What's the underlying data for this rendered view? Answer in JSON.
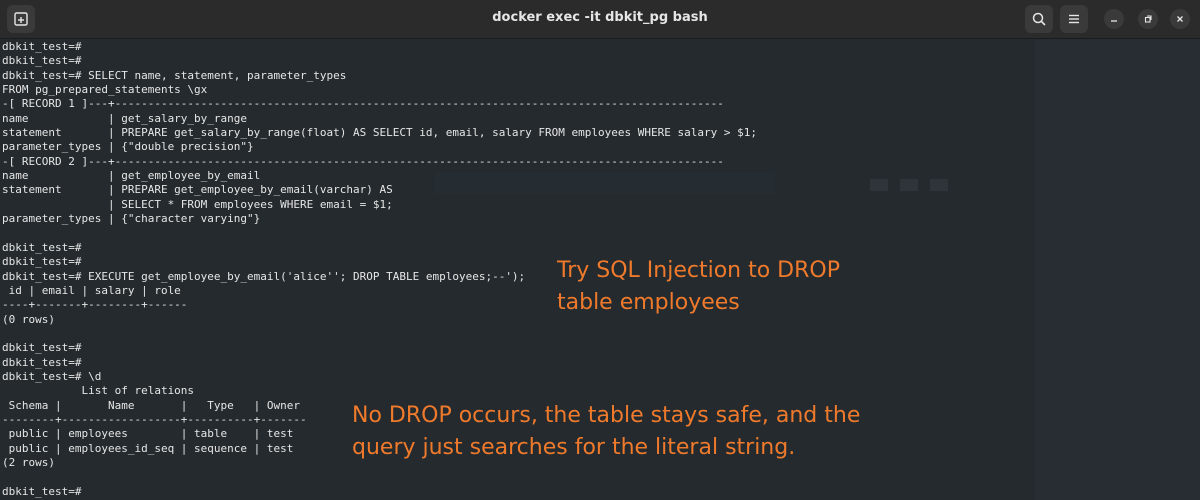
{
  "window": {
    "title": "docker exec -it dbkit_pg bash"
  },
  "terminal": {
    "lines": [
      "dbkit_test=#",
      "dbkit_test=#",
      "dbkit_test=# SELECT name, statement, parameter_types",
      "FROM pg_prepared_statements \\gx",
      "-[ RECORD 1 ]---+--------------------------------------------------------------------------------------------",
      "name            | get_salary_by_range",
      "statement       | PREPARE get_salary_by_range(float) AS SELECT id, email, salary FROM employees WHERE salary > $1;",
      "parameter_types | {\"double precision\"}",
      "-[ RECORD 2 ]---+--------------------------------------------------------------------------------------------",
      "name            | get_employee_by_email",
      "statement       | PREPARE get_employee_by_email(varchar) AS",
      "                | SELECT * FROM employees WHERE email = $1;",
      "parameter_types | {\"character varying\"}",
      "",
      "dbkit_test=#",
      "dbkit_test=#",
      "dbkit_test=# EXECUTE get_employee_by_email('alice''; DROP TABLE employees;--');",
      " id | email | salary | role",
      "----+-------+--------+------",
      "(0 rows)",
      "",
      "dbkit_test=#",
      "dbkit_test=#",
      "dbkit_test=# \\d",
      "            List of relations",
      " Schema |       Name       |   Type   | Owner",
      "--------+------------------+----------+-------",
      " public | employees        | table    | test",
      " public | employees_id_seq | sequence | test",
      "(2 rows)",
      "",
      "dbkit_test=#"
    ]
  },
  "annotations": {
    "injection": [
      "Try SQL Injection to DROP",
      "table employees"
    ],
    "result": [
      "No DROP occurs, the table stays safe, and the",
      "query just searches for the literal string."
    ]
  },
  "colors": {
    "annotation": "#f07a2b",
    "terminal_bg": "#242a2e",
    "terminal_text": "#e6e6e6",
    "titlebar_bg": "#2b2b2b"
  }
}
